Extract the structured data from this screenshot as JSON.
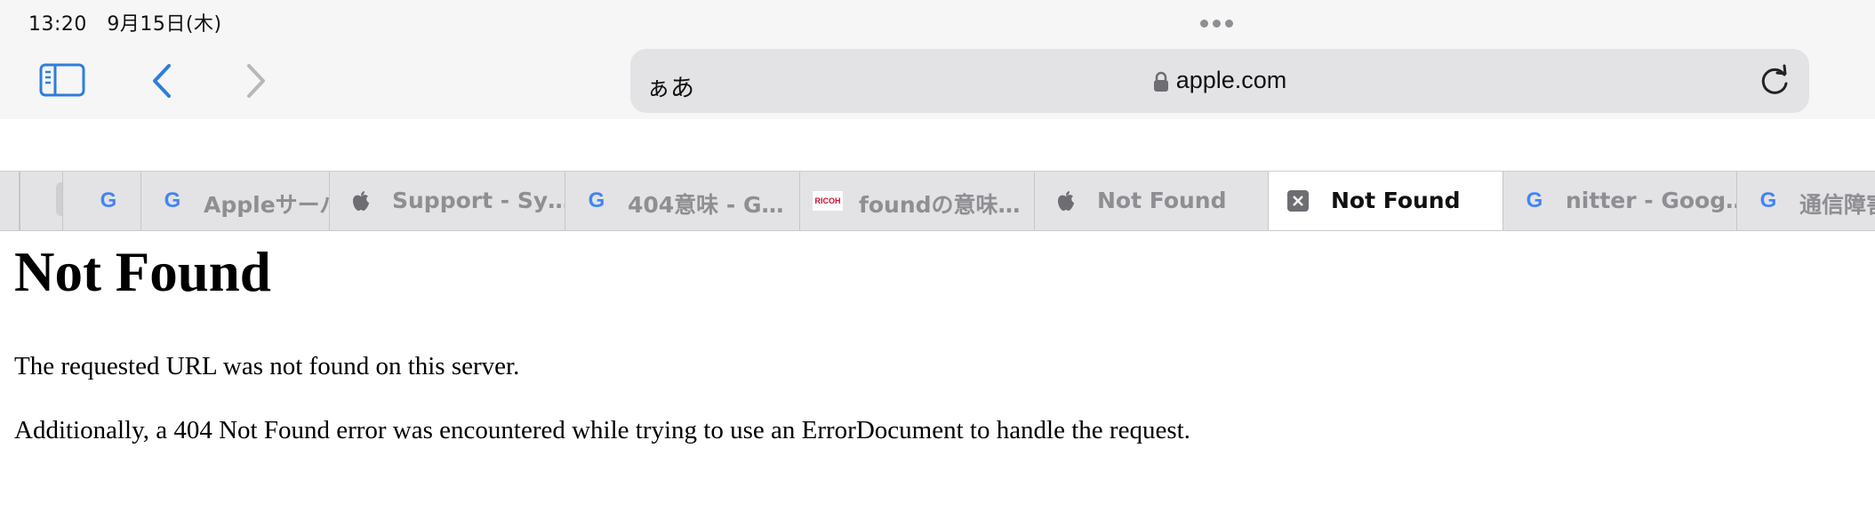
{
  "status_bar": {
    "time": "13:20",
    "date": "9月15日(木)"
  },
  "toolbar": {
    "text_size_label": "ぁあ",
    "url": "apple.com"
  },
  "tabs": [
    {
      "title": "",
      "favicon": "google-icon"
    },
    {
      "title": "Appleサーバ",
      "favicon": "google-icon"
    },
    {
      "title": "Support - Sy…",
      "favicon": "apple-icon"
    },
    {
      "title": "404意味 - G…",
      "favicon": "google-icon"
    },
    {
      "title": "foundの意味…",
      "favicon": "ricoh-icon"
    },
    {
      "title": "Not Found",
      "favicon": "apple-icon"
    },
    {
      "title": "Not Found",
      "favicon": "close-icon",
      "active": true
    },
    {
      "title": "nitter - Goog…",
      "favicon": "google-icon"
    },
    {
      "title": "通信障害",
      "favicon": "google-icon"
    }
  ],
  "page": {
    "heading": "Not Found",
    "message": "The requested URL was not found on this server.",
    "detail": "Additionally, a 404 Not Found error was encountered while trying to use an ErrorDocument to handle the request."
  },
  "colors": {
    "accent": "#2f7ed8",
    "tab_bar": "#e3e3e5",
    "address_bar": "#e3e3e5"
  }
}
